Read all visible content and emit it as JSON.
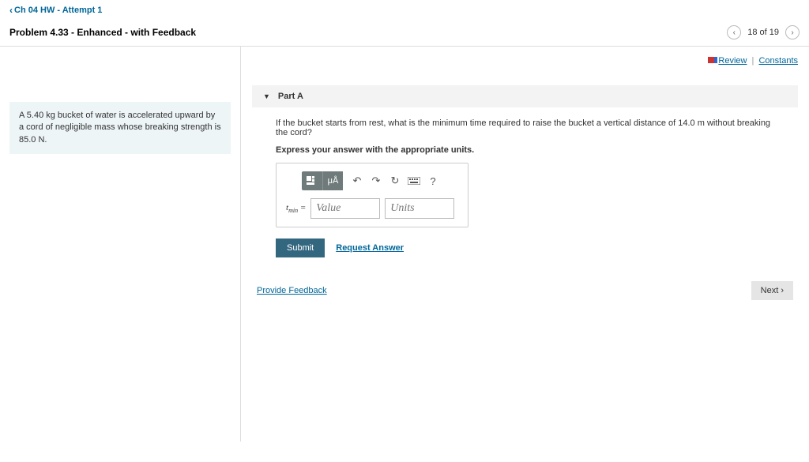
{
  "breadcrumb": "Ch 04 HW - Attempt 1",
  "title": "Problem 4.33 - Enhanced - with Feedback",
  "pager": {
    "text": "18 of 19"
  },
  "links": {
    "review": "Review",
    "constants": "Constants"
  },
  "problem_text": "A 5.40 kg bucket of water is accelerated upward by a cord of negligible mass whose breaking strength is 85.0 N.",
  "part": {
    "label": "Part A",
    "question": "If the bucket starts from rest, what is the minimum time required to raise the bucket a vertical distance of 14.0 m without breaking the cord?",
    "instruction": "Express your answer with the appropriate units."
  },
  "answer": {
    "symbol_html": "t",
    "symbol_sub": "min",
    "equals": " = ",
    "value_placeholder": "Value",
    "units_placeholder": "Units"
  },
  "buttons": {
    "submit": "Submit",
    "request": "Request Answer",
    "feedback": "Provide Feedback",
    "next": "Next",
    "tool_mu": "μÅ",
    "tool_help": "?"
  }
}
